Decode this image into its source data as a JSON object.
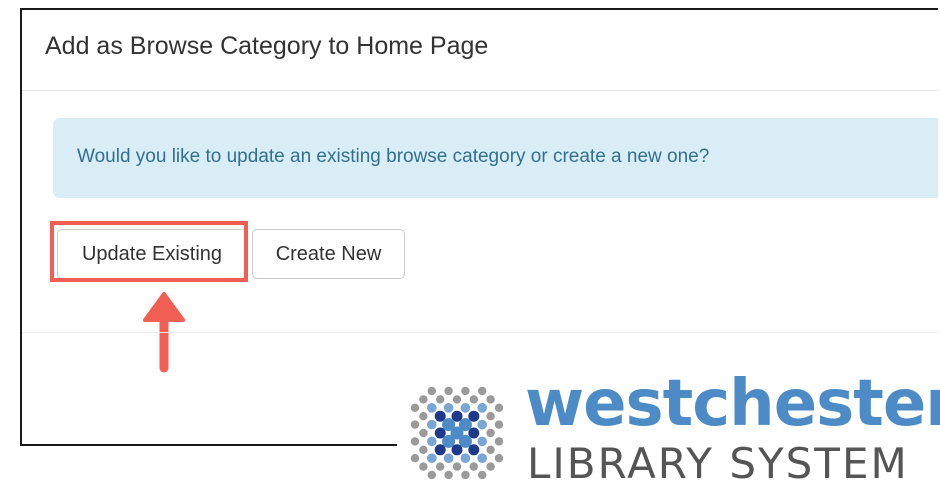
{
  "modal": {
    "title": "Add as Browse Category to Home Page",
    "alert_text": "Would you like to update an existing browse category or create a new one?",
    "buttons": {
      "update_existing": "Update Existing",
      "create_new": "Create New"
    }
  },
  "annotation": {
    "highlight_color": "#f05e54",
    "arrow_color": "#f05e54",
    "icon": "arrow-up-icon"
  },
  "logo": {
    "line1": "westchester",
    "line2": "LIBRARY SYSTEM",
    "mark_icon": "dot-grid-logo-icon",
    "brand_blue": "#4c8bc6",
    "text_gray": "#555555"
  }
}
